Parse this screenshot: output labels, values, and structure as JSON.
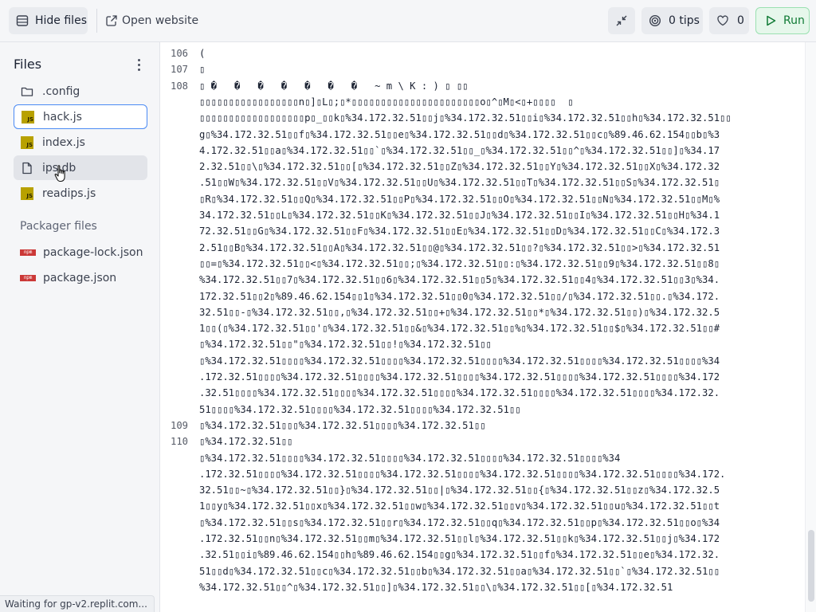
{
  "topbar": {
    "hide_files_label": "Hide files",
    "open_website_label": "Open website",
    "tips_label": "0 tips",
    "likes_count": "0",
    "run_label": "Run"
  },
  "colors": {
    "run_green": "#0f7a34",
    "selection_blue": "#4a8af4",
    "npm_red": "#cb3837",
    "js_yellow": "#b8a100"
  },
  "sidebar": {
    "title": "Files",
    "files": [
      {
        "name": ".config",
        "icon": "folder-icon"
      },
      {
        "name": "hack.js",
        "icon": "js-icon"
      },
      {
        "name": "index.js",
        "icon": "js-icon"
      },
      {
        "name": "ips.db",
        "icon": "file-icon"
      },
      {
        "name": "readips.js",
        "icon": "js-icon"
      }
    ],
    "packager_title": "Packager files",
    "packager_files": [
      {
        "name": "package-lock.json",
        "icon": "npm-icon"
      },
      {
        "name": "package.json",
        "icon": "npm-icon"
      }
    ]
  },
  "editor": {
    "lines": [
      {
        "n": "106",
        "t": "("
      },
      {
        "n": "107",
        "t": "▯"
      },
      {
        "n": "108",
        "t": "▯ �   �   �   �   �   �   �   ~ m \\ K : ) ▯ ▯▯"
      },
      {
        "n": "",
        "t": "▯▯▯▯▯▯▯▯▯▯▯▯▯▯▯▯▯n▯]▯L▯;▯*▯▯▯▯▯▯▯▯▯▯▯▯▯▯▯▯▯▯▯▯▯▯o▯^▯M▯<▯+▯▯▯▯  ▯"
      },
      {
        "n": "",
        "t": "▯▯▯▯▯▯▯▯▯▯▯▯▯▯▯▯▯▯p▯_▯▯k▯%34.172.32.51▯▯j▯%34.172.32.51▯▯i▯%34.172.32.51▯▯h▯%34.172.32.51▯▯"
      },
      {
        "n": "",
        "t": "g▯%34.172.32.51▯▯f▯%34.172.32.51▯▯e▯%34.172.32.51▯▯d▯%34.172.32.51▯▯c▯%89.46.62.154▯▯b▯%3"
      },
      {
        "n": "",
        "t": "4.172.32.51▯▯a▯%34.172.32.51▯▯`▯%34.172.32.51▯▯_▯%34.172.32.51▯▯^▯%34.172.32.51▯▯]▯%34.17"
      },
      {
        "n": "",
        "t": "2.32.51▯▯\\▯%34.172.32.51▯▯[▯%34.172.32.51▯▯Z▯%34.172.32.51▯▯Y▯%34.172.32.51▯▯X▯%34.172.32"
      },
      {
        "n": "",
        "t": ".51▯▯W▯%34.172.32.51▯▯V▯%34.172.32.51▯▯U▯%34.172.32.51▯▯T▯%34.172.32.51▯▯S▯%34.172.32.51▯"
      },
      {
        "n": "",
        "t": "▯R▯%34.172.32.51▯▯Q▯%34.172.32.51▯▯P▯%34.172.32.51▯▯O▯%34.172.32.51▯▯N▯%34.172.32.51▯▯M▯%"
      },
      {
        "n": "",
        "t": "34.172.32.51▯▯L▯%34.172.32.51▯▯K▯%34.172.32.51▯▯J▯%34.172.32.51▯▯I▯%34.172.32.51▯▯H▯%34.1"
      },
      {
        "n": "",
        "t": "72.32.51▯▯G▯%34.172.32.51▯▯F▯%34.172.32.51▯▯E▯%34.172.32.51▯▯D▯%34.172.32.51▯▯C▯%34.172.3"
      },
      {
        "n": "",
        "t": "2.51▯▯B▯%34.172.32.51▯▯A▯%34.172.32.51▯▯@▯%34.172.32.51▯▯?▯%34.172.32.51▯▯>▯%34.172.32.51"
      },
      {
        "n": "",
        "t": "▯▯=▯%34.172.32.51▯▯<▯%34.172.32.51▯▯;▯%34.172.32.51▯▯:▯%34.172.32.51▯▯9▯%34.172.32.51▯▯8▯"
      },
      {
        "n": "",
        "t": "%34.172.32.51▯▯7▯%34.172.32.51▯▯6▯%34.172.32.51▯▯5▯%34.172.32.51▯▯4▯%34.172.32.51▯▯3▯%34."
      },
      {
        "n": "",
        "t": "172.32.51▯▯2▯%89.46.62.154▯▯1▯%34.172.32.51▯▯0▯%34.172.32.51▯▯/▯%34.172.32.51▯▯.▯%34.172."
      },
      {
        "n": "",
        "t": "32.51▯▯-▯%34.172.32.51▯▯,▯%34.172.32.51▯▯+▯%34.172.32.51▯▯*▯%34.172.32.51▯▯)▯%34.172.32.5"
      },
      {
        "n": "",
        "t": "1▯▯(▯%34.172.32.51▯▯'▯%34.172.32.51▯▯&▯%34.172.32.51▯▯%▯%34.172.32.51▯▯$▯%34.172.32.51▯▯#"
      },
      {
        "n": "",
        "t": "▯%34.172.32.51▯▯\"▯%34.172.32.51▯▯!▯%34.172.32.51▯▯"
      },
      {
        "n": "",
        "t": "▯%34.172.32.51▯▯▯▯%34.172.32.51▯▯▯▯%34.172.32.51▯▯▯▯%34.172.32.51▯▯▯▯%34.172.32.51▯▯▯▯%34"
      },
      {
        "n": "",
        "t": ".172.32.51▯▯▯▯%34.172.32.51▯▯▯▯%34.172.32.51▯▯▯▯%34.172.32.51▯▯▯▯%34.172.32.51▯▯▯▯%34.172"
      },
      {
        "n": "",
        "t": ".32.51▯▯▯▯%34.172.32.51▯▯▯▯%34.172.32.51▯▯▯▯%34.172.32.51▯▯▯▯%34.172.32.51▯▯▯▯%34.172.32."
      },
      {
        "n": "",
        "t": "51▯▯▯▯%34.172.32.51▯▯▯▯%34.172.32.51▯▯▯▯%34.172.32.51▯▯"
      },
      {
        "n": "109",
        "t": "▯%34.172.32.51▯▯▯%34.172.32.51▯▯▯▯%34.172.32.51▯▯"
      },
      {
        "n": "110",
        "t": "▯%34.172.32.51▯▯"
      },
      {
        "n": "",
        "t": "▯%34.172.32.51▯▯▯▯%34.172.32.51▯▯▯▯%34.172.32.51▯▯▯▯%34.172.32.51▯▯▯▯%34"
      },
      {
        "n": "",
        "t": ".172.32.51▯▯▯▯%34.172.32.51▯▯▯▯%34.172.32.51▯▯▯▯%34.172.32.51▯▯▯▯%34.172.32.51▯▯▯▯%34.172."
      },
      {
        "n": "",
        "t": "32.51▯▯~▯%34.172.32.51▯▯}▯%34.172.32.51▯▯|▯%34.172.32.51▯▯{▯%34.172.32.51▯▯z▯%34.172.32.5"
      },
      {
        "n": "",
        "t": "1▯▯y▯%34.172.32.51▯▯x▯%34.172.32.51▯▯w▯%34.172.32.51▯▯v▯%34.172.32.51▯▯u▯%34.172.32.51▯▯t"
      },
      {
        "n": "",
        "t": "▯%34.172.32.51▯▯s▯%34.172.32.51▯▯r▯%34.172.32.51▯▯q▯%34.172.32.51▯▯p▯%34.172.32.51▯▯o▯%34"
      },
      {
        "n": "",
        "t": ".172.32.51▯▯n▯%34.172.32.51▯▯m▯%34.172.32.51▯▯l▯%34.172.32.51▯▯k▯%34.172.32.51▯▯j▯%34.172"
      },
      {
        "n": "",
        "t": ".32.51▯▯i▯%89.46.62.154▯▯h▯%89.46.62.154▯▯g▯%34.172.32.51▯▯f▯%34.172.32.51▯▯e▯%34.172.32."
      },
      {
        "n": "",
        "t": "51▯▯d▯%34.172.32.51▯▯c▯%34.172.32.51▯▯b▯%34.172.32.51▯▯a▯%34.172.32.51▯▯`▯%34.172.32.51▯▯"
      },
      {
        "n": "",
        "t": "%34.172.32.51▯▯^▯%34.172.32.51▯▯]▯%34.172.32.51▯▯\\▯%34.172.32.51▯▯[▯%34.172.32.51"
      }
    ]
  },
  "status": {
    "text": "Waiting for gp-v2.replit.com..."
  }
}
